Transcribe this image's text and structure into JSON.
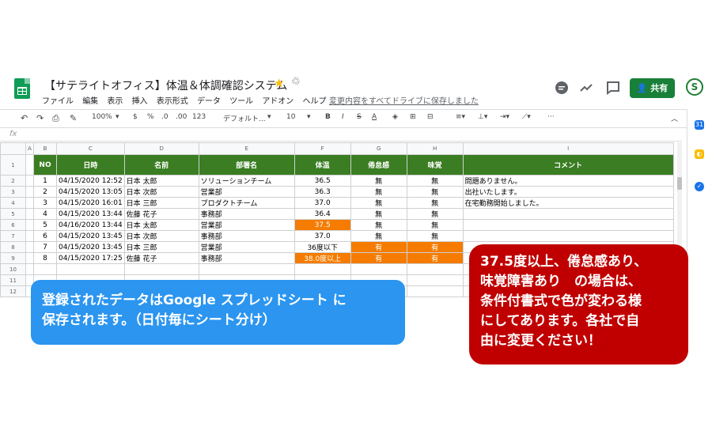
{
  "header": {
    "title": "【サテライトオフィス】体温＆体調確認システム",
    "menu": [
      "ファイル",
      "編集",
      "表示",
      "挿入",
      "表示形式",
      "データ",
      "ツール",
      "アドオン",
      "ヘルプ"
    ],
    "save_message": "変更内容をすべてドライブに保存しました",
    "share_label": "共有"
  },
  "toolbar": {
    "zoom": "100%",
    "currency": "$",
    "percent": "%",
    "dec_decrease": ".0",
    "dec_increase": ".00",
    "format_more": "123",
    "font": "デフォルト...",
    "font_size": "10",
    "bold": "B",
    "italic": "I",
    "strike": "S",
    "text_color": "A",
    "more": "···"
  },
  "formula_bar": {
    "fx": "fx"
  },
  "sheet": {
    "col_letters": [
      "A",
      "B",
      "C",
      "D",
      "E",
      "F",
      "G",
      "H",
      "I"
    ],
    "row_numbers": [
      "1",
      "2",
      "3",
      "4",
      "5",
      "6",
      "7",
      "8",
      "9",
      "10",
      "11",
      "12"
    ],
    "headers": [
      "NO",
      "日時",
      "名前",
      "部署名",
      "体温",
      "倦怠感",
      "味覚",
      "コメント"
    ],
    "rows": [
      [
        "1",
        "04/15/2020 12:52",
        "日本 太郎",
        "ソリューションチーム",
        "36.5",
        "無",
        "無",
        "問題ありません。"
      ],
      [
        "2",
        "04/15/2020 13:05",
        "日本 次郎",
        "営業部",
        "36.3",
        "無",
        "無",
        "出社いたします。"
      ],
      [
        "3",
        "04/15/2020 16:01",
        "日本 三郎",
        "プロダクトチーム",
        "37.0",
        "無",
        "無",
        "在宅勤務開始しました。"
      ],
      [
        "4",
        "04/15/2020 13:44",
        "佐藤 花子",
        "事務部",
        "36.4",
        "無",
        "無",
        ""
      ],
      [
        "5",
        "04/16/2020 13:44",
        "日本 太郎",
        "営業部",
        "37.5",
        "無",
        "無",
        ""
      ],
      [
        "6",
        "04/15/2020 13:45",
        "日本 次郎",
        "事務部",
        "37.0",
        "無",
        "無",
        ""
      ],
      [
        "7",
        "04/15/2020 13:45",
        "日本 三郎",
        "営業部",
        "36度以下",
        "有",
        "有",
        ""
      ],
      [
        "8",
        "04/15/2020 17:25",
        "佐藤 花子",
        "事務部",
        "38.0度以上",
        "有",
        "有",
        ""
      ]
    ]
  },
  "callouts": {
    "blue_line1": "登録されたデータはGoogle スプレッドシート に",
    "blue_line2": "保存されます。（日付毎にシート分け）",
    "red_line1": "37.5度以上、倦怠感あり、",
    "red_line2": "味覚障害あり　の場合は、",
    "red_line3": "条件付書式で色が変わる様",
    "red_line4": "にしてあります。各社で自",
    "red_line5": "由に変更ください！"
  },
  "colors": {
    "header_green": "#3a7d22",
    "highlight_orange": "#f57c00",
    "callout_blue": "#2b95f0",
    "callout_red": "#c00000",
    "share_green": "#188038"
  },
  "icons": [
    "sheets-logo-icon",
    "star-icon",
    "drive-icon",
    "comment-history-icon",
    "activity-icon",
    "comment-icon",
    "lock-icon",
    "avatar"
  ]
}
